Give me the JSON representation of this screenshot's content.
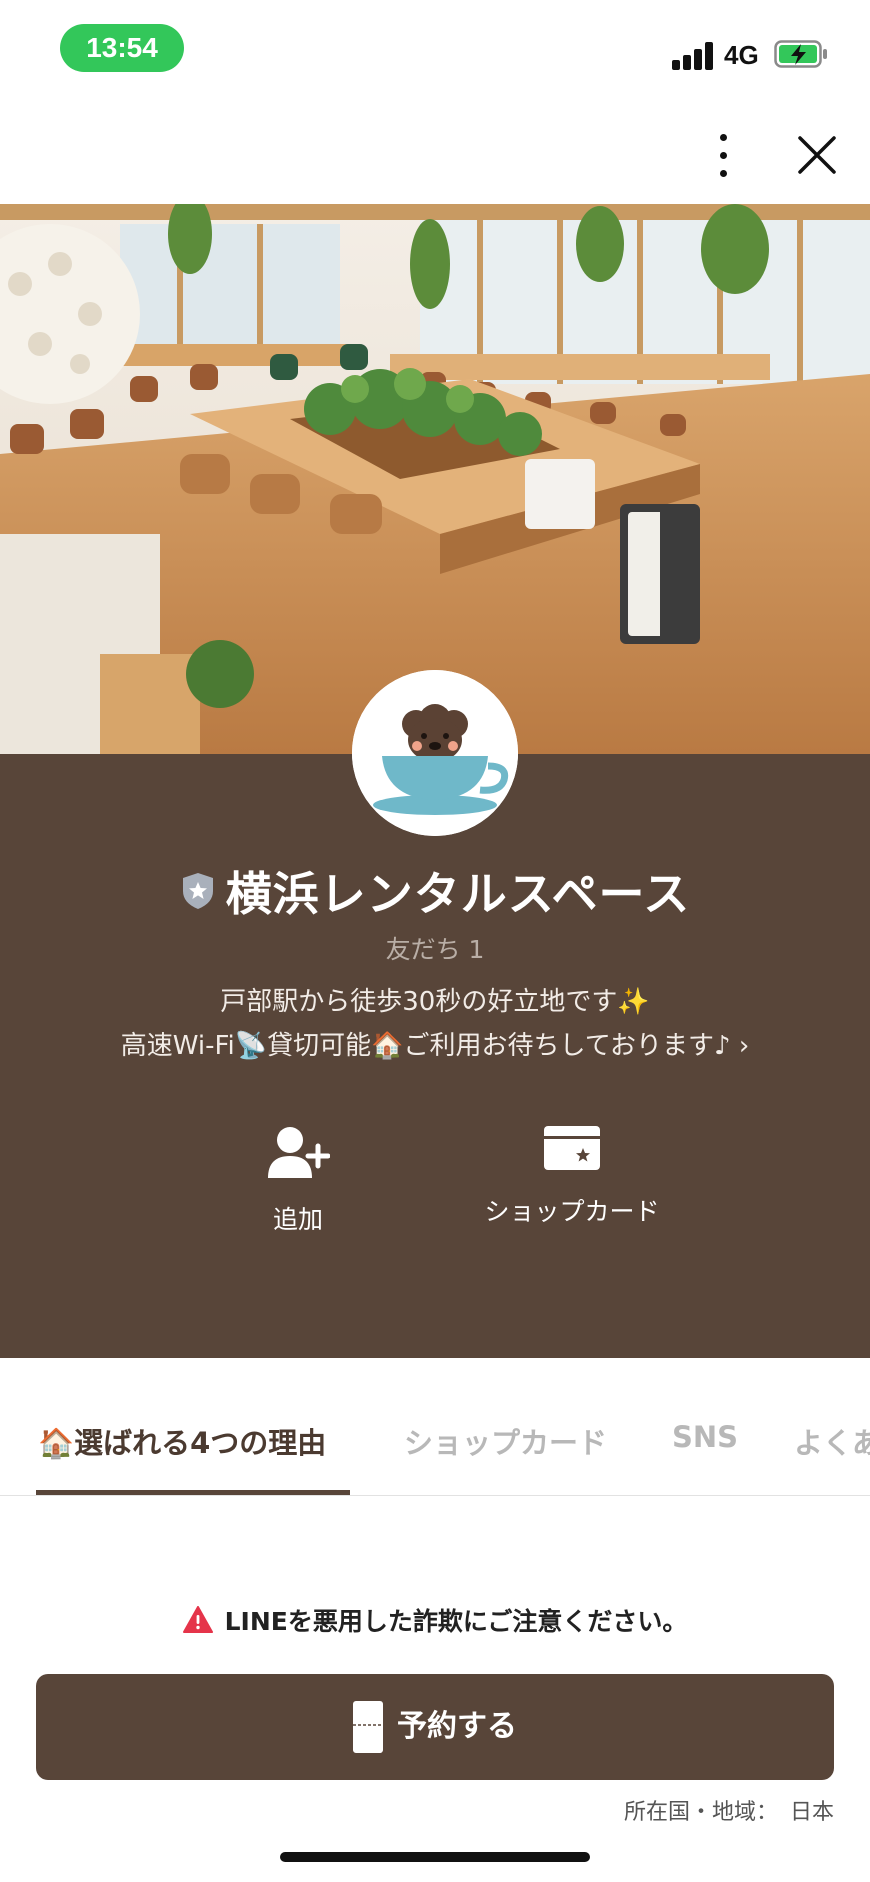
{
  "status_bar": {
    "time": "13:54",
    "network": "4G",
    "time_color": "#33c75a"
  },
  "profile": {
    "name": "横浜レンタルスペース",
    "friends": "友だち 1",
    "description_line1": "戸部駅から徒歩30秒の好立地です✨",
    "description_line2": "高速Wi-Fi📡貸切可能🏠ご利用お待ちしております♪ ›",
    "background_color": "#584539"
  },
  "actions": [
    {
      "label": "追加",
      "icon": "add-friend-icon"
    },
    {
      "label": "ショップカード",
      "icon": "shop-card-icon"
    }
  ],
  "tabs": [
    {
      "label": "🏠選ばれる4つの理由",
      "active": true
    },
    {
      "label": "ショップカード",
      "active": false
    },
    {
      "label": "SNS",
      "active": false
    },
    {
      "label": "よくあ",
      "active": false
    }
  ],
  "warning": {
    "text": "LINEを悪用した詐欺にご注意ください。",
    "icon": "warning-icon",
    "color": "#e5344a"
  },
  "reserve_button": {
    "label": "予約する",
    "icon": "phone-icon"
  },
  "region": {
    "label": "所在国・地域：",
    "value": "日本"
  }
}
